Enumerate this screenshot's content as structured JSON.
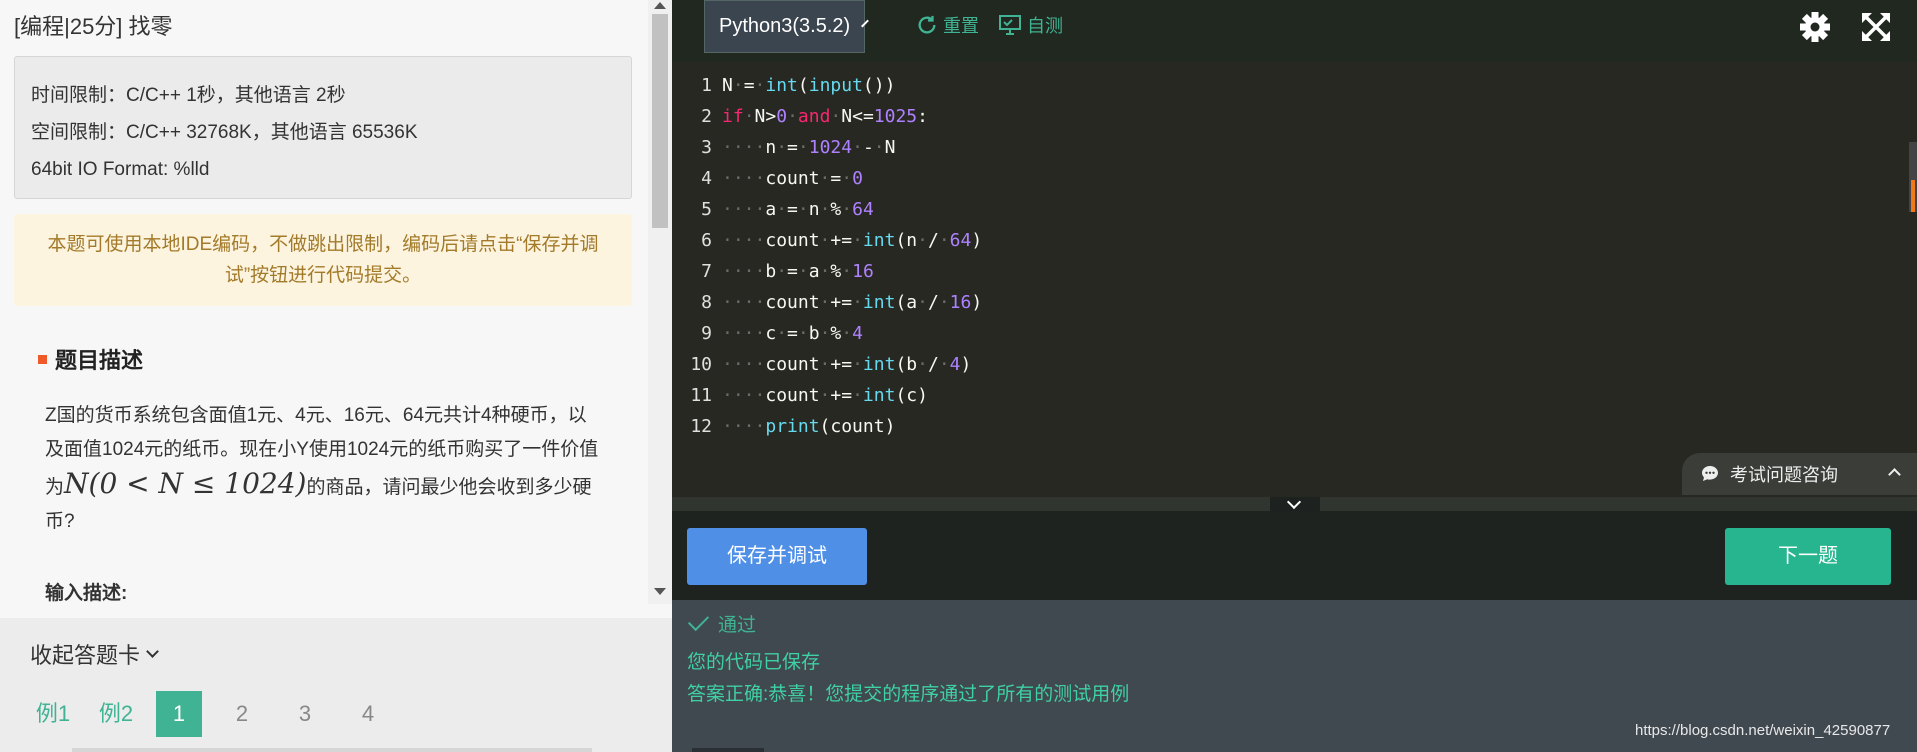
{
  "question": {
    "title": "[编程|25分] 找零",
    "limits": [
      "时间限制：C/C++ 1秒，其他语言 2秒",
      "空间限制：C/C++ 32768K，其他语言 65536K",
      "64bit IO Format: %lld"
    ],
    "notice": "本题可使用本地IDE编码，不做跳出限制，编码后请点击“保存并调试”按钮进行代码提交。",
    "section_title": "题目描述",
    "description_1": "Z国的货币系统包含面值1元、4元、16元、64元共计4种硬币，以及面值1024元的纸币。现在小Y使用1024元的纸币购买了一件价值为",
    "description_math": "N(0 < N ≤ 1024)",
    "description_2": "的商品，请问最少他会收到多少硬币?",
    "input_heading": "输入描述:"
  },
  "answer_card": {
    "toggle_label": "收起答题卡",
    "items": [
      "例1",
      "例2",
      "1",
      "2",
      "3",
      "4"
    ],
    "active_index": 2
  },
  "editor": {
    "language": "Python3(3.5.2)",
    "reset_label": "重置",
    "selftest_label": "自测",
    "settings_icon": "gear-icon",
    "fullscreen_icon": "expand-icon",
    "line_numbers": [
      "1",
      "2",
      "3",
      "4",
      "5",
      "6",
      "7",
      "8",
      "9",
      "10",
      "11",
      "12"
    ],
    "code_lines": [
      "N = int(input())",
      "if N>0 and N<=1025:",
      "    n = 1024 - N",
      "    count = 0",
      "    a = n % 64",
      "    count += int(n / 64)",
      "    b = a % 16",
      "    count += int(a / 16)",
      "    c = b % 4",
      "    count += int(b / 4)",
      "    count += int(c)",
      "    print(count)"
    ],
    "consult_label": "考试问题咨询"
  },
  "actions": {
    "save_label": "保存并调试",
    "next_label": "下一题"
  },
  "result": {
    "status": "通过",
    "message_saved": "您的代码已保存",
    "message_correct": "答案正确:恭喜！您提交的程序通过了所有的测试用例",
    "watermark": "https://blog.csdn.net/weixin_42590877"
  },
  "colors": {
    "accent_green": "#3fb393",
    "save_blue": "#4f8fe6",
    "next_green": "#26b58e",
    "editor_bg": "#272822",
    "notice_bg": "#fcf4de",
    "notice_text": "#a37a2a",
    "keyword": "#f92672",
    "builtin": "#66d9ef",
    "number": "#ae81ff"
  }
}
